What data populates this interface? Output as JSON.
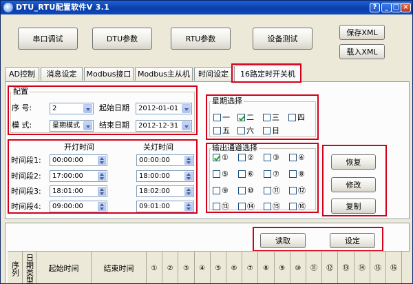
{
  "window": {
    "title": "DTU_RTU配置软件V 3.1"
  },
  "toolbar": {
    "serial_debug": "串口调试",
    "dtu_params": "DTU参数",
    "rtu_params": "RTU参数",
    "device_test": "设备测试",
    "save_xml": "保存XML",
    "load_xml": "载入XML"
  },
  "tabs": [
    {
      "label": "AD控制"
    },
    {
      "label": "消息设定"
    },
    {
      "label": "Modbus接口"
    },
    {
      "label": "Modbus主从机"
    },
    {
      "label": "时间设定"
    },
    {
      "label": "16路定时开关机"
    }
  ],
  "config": {
    "title": "配置",
    "seq_label": "序  号:",
    "seq_value": "2",
    "mode_label": "模  式:",
    "mode_value": "星期模式",
    "start_date_label": "起始日期",
    "start_date_value": "2012-01-01",
    "end_date_label": "结束日期",
    "end_date_value": "2012-12-31"
  },
  "weekday": {
    "title": "星期选择",
    "items": [
      {
        "label": "一",
        "checked": false
      },
      {
        "label": "二",
        "checked": true
      },
      {
        "label": "三",
        "checked": false
      },
      {
        "label": "四",
        "checked": false
      },
      {
        "label": "五",
        "checked": false
      },
      {
        "label": "六",
        "checked": false
      },
      {
        "label": "日",
        "checked": false
      }
    ]
  },
  "times": {
    "on_header": "开灯时间",
    "off_header": "关灯时间",
    "rows": [
      {
        "label": "时间段1:",
        "on": "00:00:00",
        "off": "00:00:00"
      },
      {
        "label": "时间段2:",
        "on": "17:00:00",
        "off": "18:00:00"
      },
      {
        "label": "时间段3:",
        "on": "18:01:00",
        "off": "18:02:00"
      },
      {
        "label": "时间段4:",
        "on": "09:00:00",
        "off": "09:01:00"
      }
    ]
  },
  "channels": {
    "title": "输出通道选择",
    "items": [
      {
        "label": "①",
        "checked": true
      },
      {
        "label": "②",
        "checked": false
      },
      {
        "label": "③",
        "checked": false
      },
      {
        "label": "④",
        "checked": false
      },
      {
        "label": "⑤",
        "checked": false
      },
      {
        "label": "⑥",
        "checked": false
      },
      {
        "label": "⑦",
        "checked": false
      },
      {
        "label": "⑧",
        "checked": false
      },
      {
        "label": "⑨",
        "checked": false
      },
      {
        "label": "⑩",
        "checked": false
      },
      {
        "label": "⑪",
        "checked": false
      },
      {
        "label": "⑫",
        "checked": false
      },
      {
        "label": "⑬",
        "checked": false
      },
      {
        "label": "⑭",
        "checked": false
      },
      {
        "label": "⑮",
        "checked": false
      },
      {
        "label": "⑯",
        "checked": false
      }
    ]
  },
  "actions": {
    "restore": "恢复",
    "modify": "修改",
    "copy": "复制"
  },
  "readset": {
    "read": "读取",
    "set": "设定"
  },
  "grid": {
    "headers": [
      "序列",
      "日期类型",
      "起始时间",
      "结束时间"
    ],
    "channel_headers": [
      "①",
      "②",
      "③",
      "④",
      "⑤",
      "⑥",
      "⑦",
      "⑧",
      "⑨",
      "⑩",
      "⑪",
      "⑫",
      "⑬",
      "⑭",
      "⑮",
      "⑯"
    ]
  }
}
